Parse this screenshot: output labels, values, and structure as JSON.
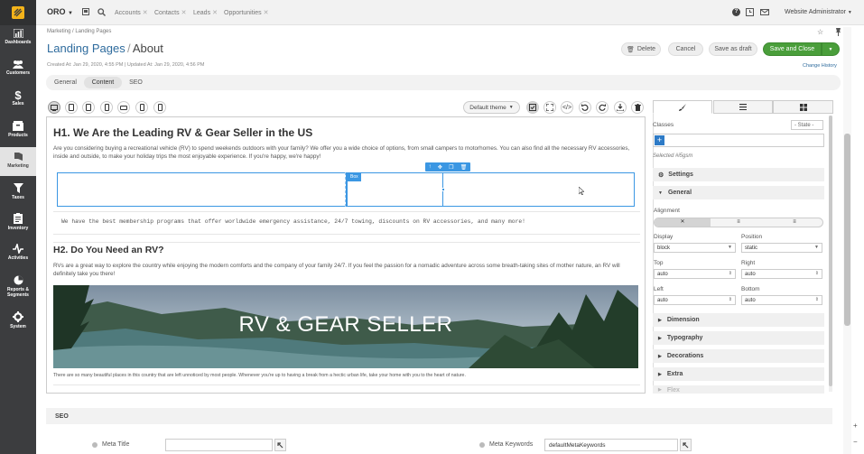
{
  "sidebar": {
    "items": [
      {
        "label": "Dashboards",
        "icon": "bar-chart-icon"
      },
      {
        "label": "Customers",
        "icon": "users-icon"
      },
      {
        "label": "Sales",
        "icon": "dollar-icon"
      },
      {
        "label": "Products",
        "icon": "box-icon"
      },
      {
        "label": "Marketing",
        "icon": "book-icon"
      },
      {
        "label": "Taxes",
        "icon": "filter-icon"
      },
      {
        "label": "Inventory",
        "icon": "clipboard-icon"
      },
      {
        "label": "Activities",
        "icon": "activity-icon"
      },
      {
        "label": "Reports & Segments",
        "icon": "pie-chart-icon"
      },
      {
        "label": "System",
        "icon": "gear-icon"
      }
    ]
  },
  "topbar": {
    "brand": "ORO",
    "tabs": [
      "Accounts",
      "Contacts",
      "Leads",
      "Opportunities"
    ],
    "user": "Website Administrator"
  },
  "header": {
    "breadcrumb": "Marketing / Landing Pages",
    "title_section": "Landing Pages",
    "title_sep": "/",
    "title_page": "About",
    "meta": "Created At: Jan 29, 2020, 4:55 PM  |  Updated At: Jan 29, 2020, 4:56 PM",
    "delete": "Delete",
    "cancel": "Cancel",
    "save_draft": "Save as draft",
    "save_close": "Save and Close",
    "change_history": "Change History"
  },
  "tabs": [
    "General",
    "Content",
    "SEO"
  ],
  "editor": {
    "theme": "Default theme",
    "canvas": {
      "h1": "H1. We Are the Leading RV & Gear Seller in the US",
      "p1": "Are you considering buying a recreational vehicle (RV) to spend weekends outdoors with your family? We offer you a wide choice of options, from small campers to motorhomes. You can also find all the necessary RV accessories, inside and outside, to make your holiday trips the most enjoyable experience. If you're happy, we're happy!",
      "box_badge": "Box",
      "mono": "We have the best membership programs that offer worldwide emergency assistance, 24/7 towing, discounts on RV accessories, and many more!",
      "h2": "H2. Do You Need an RV?",
      "p2": "RVs are a great way to explore the country while enjoying the modern comforts and the company of your family 24/7. If you feel the passion for a nomadic adventure across some breath-taking sites of mother nature, an RV will definitely take you there!",
      "banner": "RV & GEAR SELLER",
      "caption": "There are so many beautiful places in this country that are left unnoticed by most people. Whenever you're up to having a break from a hectic urban life, take your home with you to the heart of nature."
    }
  },
  "panel": {
    "classes_label": "Classes",
    "state": "- State -",
    "add": "+",
    "selected": "Selected #i5gsm",
    "settings": "Settings",
    "general": "General",
    "alignment": "Alignment",
    "display_label": "Display",
    "display_value": "block",
    "position_label": "Position",
    "position_value": "static",
    "top_label": "Top",
    "top_value": "auto",
    "right_label": "Right",
    "right_value": "auto",
    "left_label": "Left",
    "left_value": "auto",
    "bottom_label": "Bottom",
    "bottom_value": "auto",
    "sections": [
      "Dimension",
      "Typography",
      "Decorations",
      "Extra",
      "Flex"
    ]
  },
  "seo": {
    "heading": "SEO",
    "meta_title_label": "Meta Title",
    "meta_title_value": "",
    "meta_keywords_label": "Meta Keywords",
    "meta_keywords_value": "defaultMetaKeywords"
  }
}
